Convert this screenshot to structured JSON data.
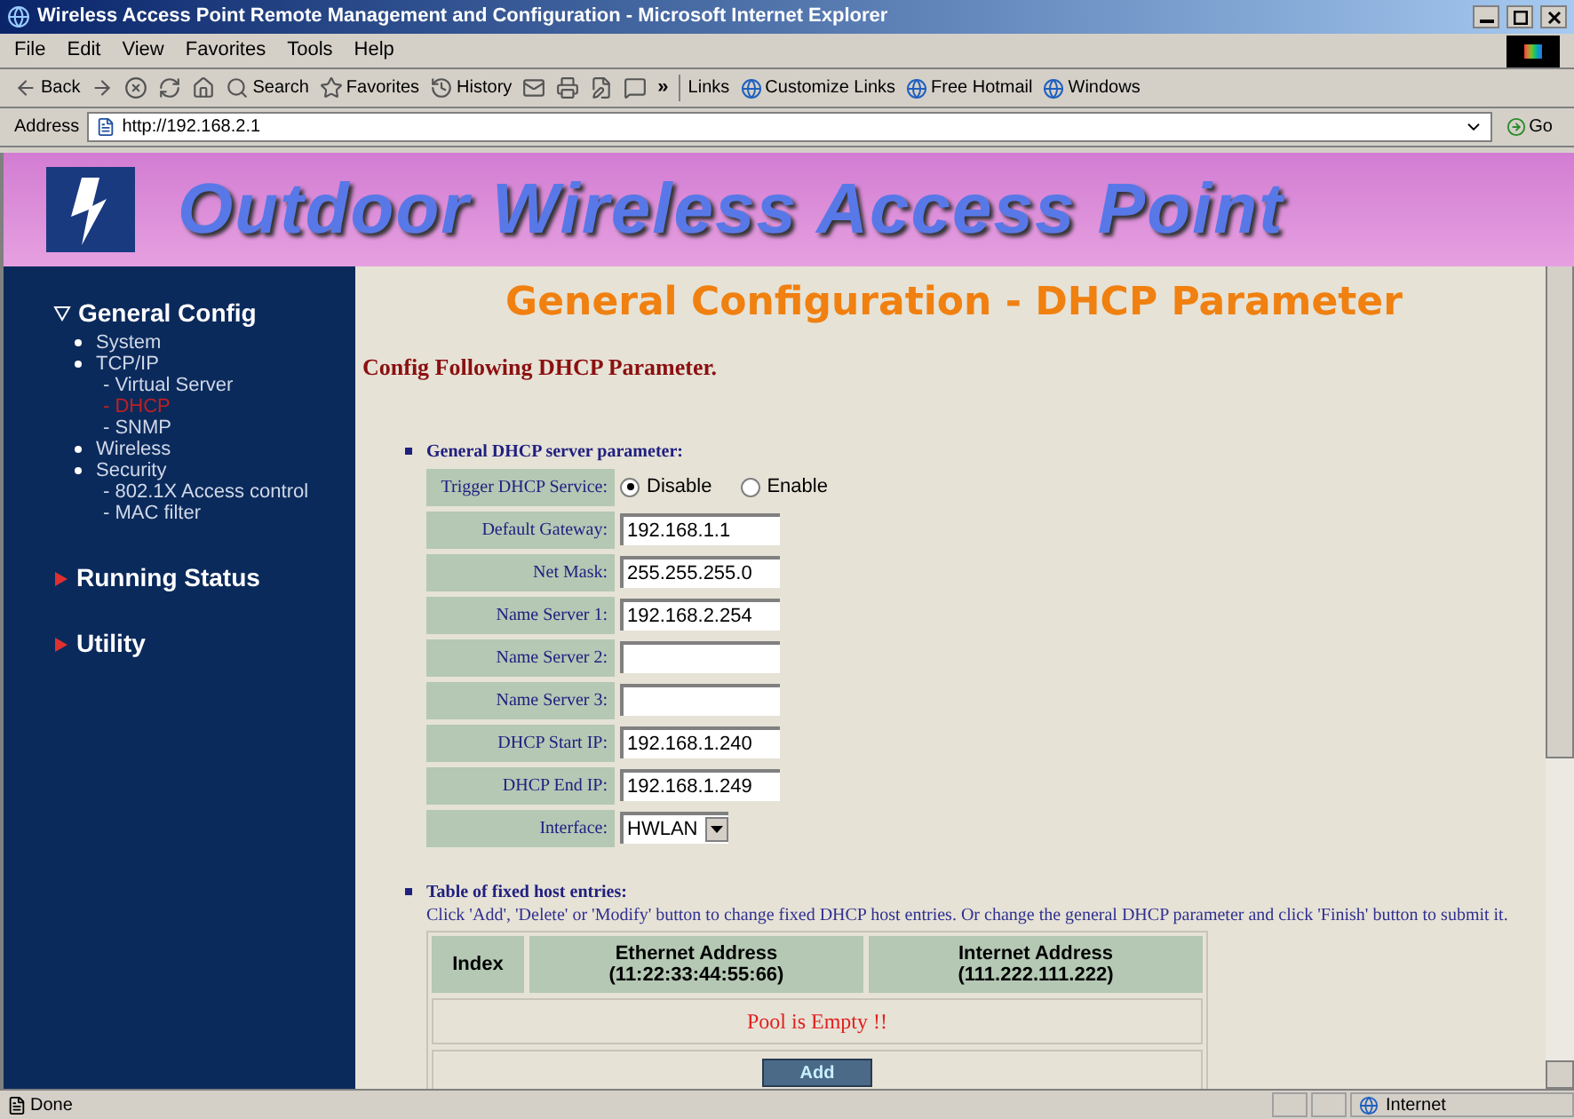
{
  "window": {
    "title": "Wireless Access Point Remote Management and Configuration - Microsoft Internet Explorer"
  },
  "menu": [
    "File",
    "Edit",
    "View",
    "Favorites",
    "Tools",
    "Help"
  ],
  "toolbar": [
    {
      "kind": "back",
      "label": "Back"
    },
    {
      "kind": "forward"
    },
    {
      "kind": "stop"
    },
    {
      "kind": "refresh"
    },
    {
      "kind": "home"
    },
    {
      "kind": "search",
      "label": "Search"
    },
    {
      "kind": "favorites",
      "label": "Favorites"
    },
    {
      "kind": "history",
      "label": "History"
    },
    {
      "kind": "mail"
    },
    {
      "kind": "print"
    },
    {
      "kind": "edit"
    },
    {
      "kind": "discuss"
    }
  ],
  "links": {
    "more": "»",
    "label": "Links",
    "items": [
      "Customize Links",
      "Free Hotmail",
      "Windows"
    ]
  },
  "address": {
    "label": "Address",
    "value": "http://192.168.2.1",
    "go": "Go"
  },
  "banner": {
    "title": "Outdoor Wireless Access Point"
  },
  "sidebar": [
    {
      "label": "General Config",
      "expanded": true,
      "children": [
        {
          "label": "System",
          "selected": false
        },
        {
          "label": "TCP/IP",
          "selected": false,
          "children": [
            {
              "label": "- Virtual Server",
              "selected": false
            },
            {
              "label": "- DHCP",
              "selected": true
            },
            {
              "label": "- SNMP",
              "selected": false
            }
          ]
        },
        {
          "label": "Wireless",
          "selected": false
        },
        {
          "label": "Security",
          "selected": false,
          "children": [
            {
              "label": "- 802.1X Access control",
              "selected": false
            },
            {
              "label": "- MAC filter",
              "selected": false
            }
          ]
        }
      ]
    },
    {
      "label": "Running Status",
      "expanded": false
    },
    {
      "label": "Utility",
      "expanded": false
    }
  ],
  "content": {
    "heading": "General Configuration - DHCP Parameter",
    "subheading": "Config Following DHCP Parameter.",
    "server_section": {
      "title": "General DHCP server parameter:",
      "fields": [
        {
          "kind": "radio",
          "label": "Trigger DHCP Service:",
          "options": [
            {
              "label": "Disable",
              "selected": true
            },
            {
              "label": "Enable",
              "selected": false
            }
          ]
        },
        {
          "kind": "text",
          "label": "Default Gateway:",
          "value": "192.168.1.1"
        },
        {
          "kind": "text",
          "label": "Net Mask:",
          "value": "255.255.255.0"
        },
        {
          "kind": "text",
          "label": "Name Server 1:",
          "value": "192.168.2.254"
        },
        {
          "kind": "text",
          "label": "Name Server 2:"
        },
        {
          "kind": "text",
          "label": "Name Server 3:"
        },
        {
          "kind": "text",
          "label": "DHCP Start IP:",
          "value": "192.168.1.240"
        },
        {
          "kind": "text",
          "label": "DHCP End IP:",
          "value": "192.168.1.249"
        },
        {
          "kind": "select",
          "label": "Interface:",
          "value": "HWLAN"
        }
      ]
    },
    "hosts_section": {
      "title": "Table of fixed host entries:",
      "description": "Click 'Add', 'Delete' or 'Modify' button to change fixed DHCP host entries. Or change the general DHCP parameter and click 'Finish' button to submit it.",
      "columns": [
        {
          "title": "Index"
        },
        {
          "title": "Ethernet Address",
          "hint": "(11:22:33:44:55:66)"
        },
        {
          "title": "Internet Address",
          "hint": "(111.222.111.222)"
        }
      ],
      "empty_message": "Pool is Empty !!",
      "add_button": "Add"
    }
  },
  "status_bar": {
    "text": "Done",
    "zone": "Internet"
  }
}
